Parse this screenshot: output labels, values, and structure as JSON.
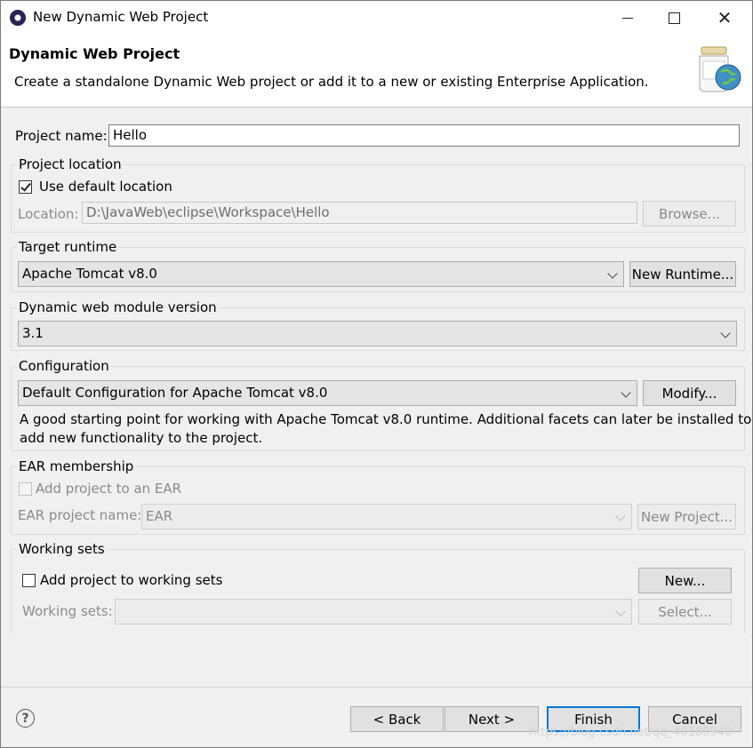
{
  "window": {
    "title": "New Dynamic Web Project"
  },
  "banner": {
    "title": "Dynamic Web Project",
    "description": "Create a standalone Dynamic Web project or add it to a new or existing Enterprise Application."
  },
  "project_name": {
    "label": "Project name:",
    "value": "Hello"
  },
  "project_location": {
    "title": "Project location",
    "use_default_label": "Use default location",
    "use_default_checked": true,
    "location_label": "Location:",
    "location_value": "D:\\JavaWeb\\eclipse\\Workspace\\Hello",
    "browse_label": "Browse..."
  },
  "target_runtime": {
    "title": "Target runtime",
    "selected": "Apache Tomcat v8.0",
    "new_runtime_label": "New Runtime..."
  },
  "module_version": {
    "title": "Dynamic web module version",
    "selected": "3.1"
  },
  "configuration": {
    "title": "Configuration",
    "selected": "Default Configuration for Apache Tomcat v8.0",
    "modify_label": "Modify...",
    "description_line1": "A good starting point for working with Apache Tomcat v8.0 runtime. Additional facets can later be installed to",
    "description_line2": "add new functionality to the project."
  },
  "ear": {
    "title": "EAR membership",
    "add_label": "Add project to an EAR",
    "project_name_label": "EAR project name:",
    "project_name_value": "EAR",
    "new_project_label": "New Project..."
  },
  "working_sets": {
    "title": "Working sets",
    "add_label": "Add project to working sets",
    "new_label": "New...",
    "sets_label": "Working sets:",
    "select_label": "Select..."
  },
  "footer": {
    "help_glyph": "?",
    "back_label": "< Back",
    "next_label": "Next >",
    "finish_label": "Finish",
    "cancel_label": "Cancel",
    "watermark": "https://blog.csdn.net/qq_40180940"
  },
  "colors": {
    "accent": "#0078d7",
    "dialog_bg": "#f0f0f0"
  }
}
